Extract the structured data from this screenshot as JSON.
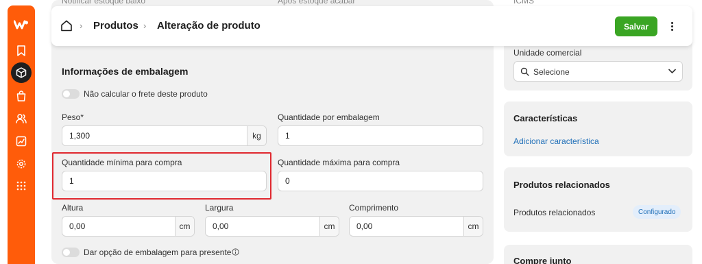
{
  "top_ghost": {
    "left": "Notificar estoque baixo",
    "middle": "Após estoque acabar",
    "right": "ICMS"
  },
  "header": {
    "home_icon": "home-icon",
    "breadcrumb": [
      "Produtos",
      "Alteração de produto"
    ],
    "save_label": "Salvar",
    "save_color": "#3aa523"
  },
  "sidebar": {
    "color": "#ff5c0a",
    "items": [
      "bookmark-icon",
      "box-icon",
      "shopping-bag-icon",
      "users-icon",
      "chart-icon",
      "gear-icon",
      "grid-icon"
    ],
    "active_index": 1
  },
  "packaging": {
    "title": "Informações de embalagem",
    "no_freight_label": "Não calcular o frete deste produto",
    "weight_label": "Peso*",
    "weight_value": "1,300",
    "weight_unit": "kg",
    "qty_per_pack_label": "Quantidade por embalagem",
    "qty_per_pack_value": "1",
    "min_qty_label": "Quantidade mínima para compra",
    "min_qty_value": "1",
    "max_qty_label": "Quantidade máxima para compra",
    "max_qty_value": "0",
    "height_label": "Altura",
    "height_value": "0,00",
    "width_label": "Largura",
    "width_value": "0,00",
    "length_label": "Comprimento",
    "length_value": "0,00",
    "dim_unit": "cm",
    "gift_label": "Dar opção de embalagem para presente"
  },
  "right": {
    "unit_label": "Unidade comercial",
    "unit_placeholder": "Selecione",
    "features_title": "Características",
    "features_link": "Adicionar característica",
    "related_title": "Produtos relacionados",
    "related_label": "Produtos relacionados",
    "related_badge": "Configurado",
    "buy_together_title": "Compre junto"
  }
}
